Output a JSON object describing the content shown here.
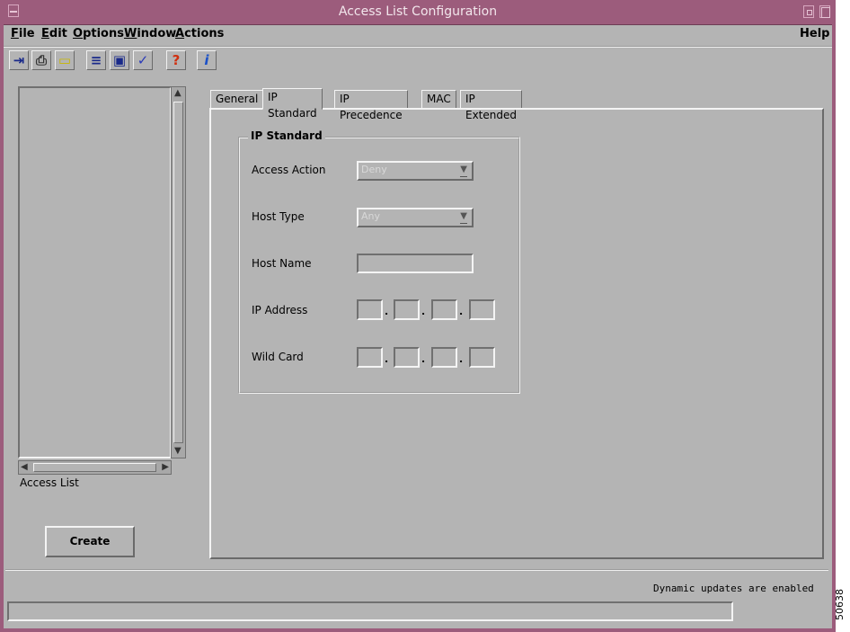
{
  "window": {
    "title": "Access List Configuration"
  },
  "menubar": {
    "items": [
      {
        "label": "File",
        "accel": "F",
        "rest": "ile"
      },
      {
        "label": "Edit",
        "accel": "E",
        "rest": "dit"
      },
      {
        "label": "Options",
        "accel": "O",
        "rest": "ptions"
      },
      {
        "label": "Window",
        "accel": "W",
        "rest": "indow"
      },
      {
        "label": "Actions",
        "accel": "A",
        "rest": "ctions"
      },
      {
        "label": "Help",
        "accel": "",
        "rest": "Help"
      }
    ]
  },
  "toolbar": {
    "icons": [
      "exit-icon",
      "print-icon",
      "open-folder-icon",
      "list-icon",
      "monitor-icon",
      "checkmark-icon",
      "help-question-icon",
      "info-icon"
    ],
    "glyphs": [
      "⇥",
      "⎙",
      "▭",
      "≡",
      "▣",
      "✓",
      "?",
      "i"
    ]
  },
  "left_panel": {
    "list_caption": "Access List",
    "create_label": "Create"
  },
  "tabs": [
    {
      "label": "General",
      "active": false
    },
    {
      "label": "IP Standard",
      "active": true
    },
    {
      "label": "IP Precedence",
      "active": false
    },
    {
      "label": "MAC",
      "active": false
    },
    {
      "label": "IP Extended",
      "active": false
    }
  ],
  "form": {
    "group_title": "IP Standard",
    "access_action_label": "Access Action",
    "access_action_value": "Deny",
    "host_type_label": "Host Type",
    "host_type_value": "Any",
    "host_name_label": "Host Name",
    "host_name_value": "",
    "ip_address_label": "IP Address",
    "wild_card_label": "Wild Card"
  },
  "status": {
    "message": "Dynamic updates are enabled",
    "field_value": ""
  },
  "figure_id": "50638",
  "colors": {
    "title_bar": "#9c5c7c",
    "window_bg": "#b4b4b4"
  }
}
